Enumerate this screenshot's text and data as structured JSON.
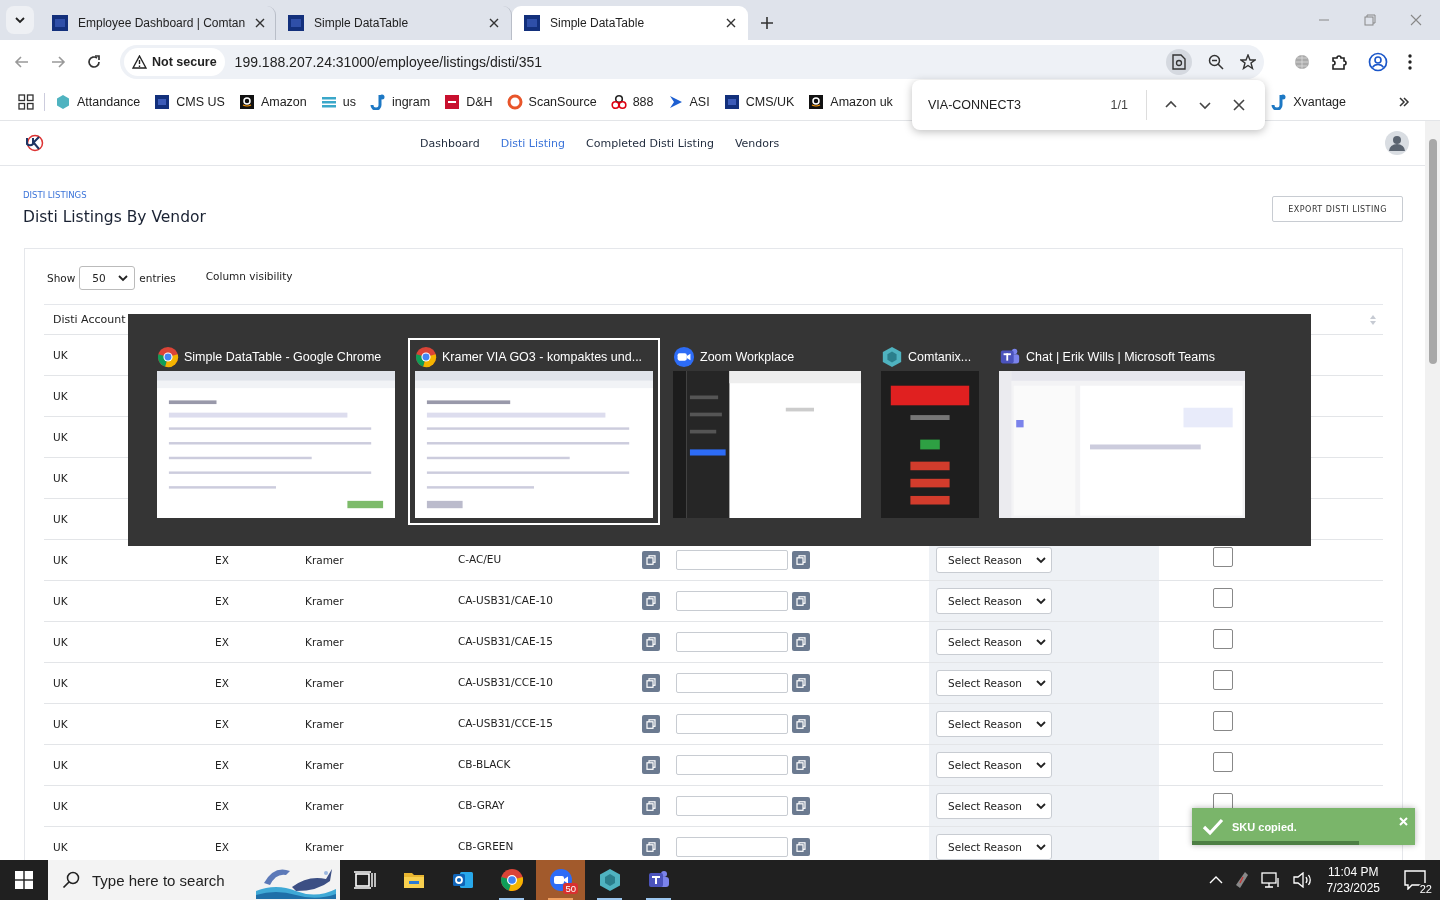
{
  "browser": {
    "tabs": [
      {
        "title": "Employee Dashboard | Comtan",
        "selected": false
      },
      {
        "title": "Simple DataTable",
        "selected": false
      },
      {
        "title": "Simple DataTable",
        "selected": true
      }
    ],
    "security": "Not secure",
    "url": "199.188.207.24:31000/employee/listings/disti/351",
    "bookmarks": [
      {
        "label": "Attandance",
        "kind": "hexagon"
      },
      {
        "label": "CMS US",
        "kind": "square"
      },
      {
        "label": "Amazon",
        "kind": "letterbox"
      },
      {
        "label": "us",
        "kind": "stripes"
      },
      {
        "label": "ingram",
        "kind": "hook"
      },
      {
        "label": "D&H",
        "kind": "redsquare"
      },
      {
        "label": "ScanSource",
        "kind": "ring"
      },
      {
        "label": "888",
        "kind": "circles"
      },
      {
        "label": "ASI",
        "kind": "arrow"
      },
      {
        "label": "CMS/UK",
        "kind": "square"
      },
      {
        "label": "Amazon uk",
        "kind": "letterbox"
      },
      {
        "label": "Xvantage",
        "kind": "hook"
      }
    ]
  },
  "find_bar": {
    "query": "VIA-CONNECT3",
    "count": "1/1"
  },
  "nav": {
    "items": [
      {
        "label": "Dashboard",
        "selected": false
      },
      {
        "label": "Disti Listing",
        "selected": true
      },
      {
        "label": "Completed Disti Listing",
        "selected": false
      },
      {
        "label": "Vendors",
        "selected": false
      }
    ]
  },
  "page": {
    "breadcrumb": "DISTI LISTINGS",
    "title": "Disti Listings By Vendor",
    "export_button": "EXPORT DISTI LISTING"
  },
  "table_controls": {
    "show": "Show",
    "page_size": "50",
    "entries": "entries",
    "column_visibility": "Column visibility"
  },
  "table": {
    "columns": [
      "Disti Account"
    ],
    "rows": [
      {
        "disti_account": "UK"
      },
      {
        "disti_account": "UK"
      },
      {
        "disti_account": "UK"
      },
      {
        "disti_account": "UK"
      },
      {
        "disti_account": "UK"
      },
      {
        "disti_account": "UK",
        "disti": "EX",
        "cms_vendor": "Kramer",
        "sku_vendor": "C-AC/EU",
        "reason": "Select Reason",
        "refurbed": false
      },
      {
        "disti_account": "UK",
        "disti": "EX",
        "cms_vendor": "Kramer",
        "sku_vendor": "CA-USB31/CAE-10",
        "reason": "Select Reason",
        "refurbed": false
      },
      {
        "disti_account": "UK",
        "disti": "EX",
        "cms_vendor": "Kramer",
        "sku_vendor": "CA-USB31/CAE-15",
        "reason": "Select Reason",
        "refurbed": false
      },
      {
        "disti_account": "UK",
        "disti": "EX",
        "cms_vendor": "Kramer",
        "sku_vendor": "CA-USB31/CCE-10",
        "reason": "Select Reason",
        "refurbed": false
      },
      {
        "disti_account": "UK",
        "disti": "EX",
        "cms_vendor": "Kramer",
        "sku_vendor": "CA-USB31/CCE-15",
        "reason": "Select Reason",
        "refurbed": false
      },
      {
        "disti_account": "UK",
        "disti": "EX",
        "cms_vendor": "Kramer",
        "sku_vendor": "CB-BLACK",
        "reason": "Select Reason",
        "refurbed": false
      },
      {
        "disti_account": "UK",
        "disti": "EX",
        "cms_vendor": "Kramer",
        "sku_vendor": "CB-GRAY",
        "reason": "Select Reason",
        "refurbed": false
      },
      {
        "disti_account": "UK",
        "disti": "EX",
        "cms_vendor": "Kramer",
        "sku_vendor": "CB-GREEN",
        "reason": "Select Reason"
      }
    ]
  },
  "task_switcher": {
    "windows": [
      {
        "title": "Simple DataTable - Google Chrome",
        "kind": "chrome",
        "selected": false
      },
      {
        "title": "Kramer VIA GO3 - kompaktes und...",
        "kind": "chrome",
        "selected": true
      },
      {
        "title": "Zoom Workplace",
        "kind": "zoom",
        "selected": false
      },
      {
        "title": "Comtanix...",
        "kind": "comtanix",
        "selected": false
      },
      {
        "title": "Chat | Erik Wills | Microsoft Teams",
        "kind": "teams",
        "selected": false
      }
    ]
  },
  "toast": {
    "message": "SKU copied.",
    "level": 0.75
  },
  "taskbar": {
    "search_placeholder": "Type here to search",
    "apps": [
      {
        "kind": "taskview",
        "running": false,
        "selected": false
      },
      {
        "kind": "explorer",
        "running": false,
        "selected": false
      },
      {
        "kind": "outlook",
        "running": false,
        "selected": false
      },
      {
        "kind": "chrome",
        "running": true,
        "selected": false
      },
      {
        "kind": "zoom",
        "running": true,
        "selected": true,
        "badge": "50"
      },
      {
        "kind": "comtanix",
        "running": true,
        "selected": false
      },
      {
        "kind": "teams",
        "running": true,
        "selected": false
      }
    ],
    "time": "11:04 PM",
    "date": "7/23/2025",
    "notifications": "22"
  }
}
